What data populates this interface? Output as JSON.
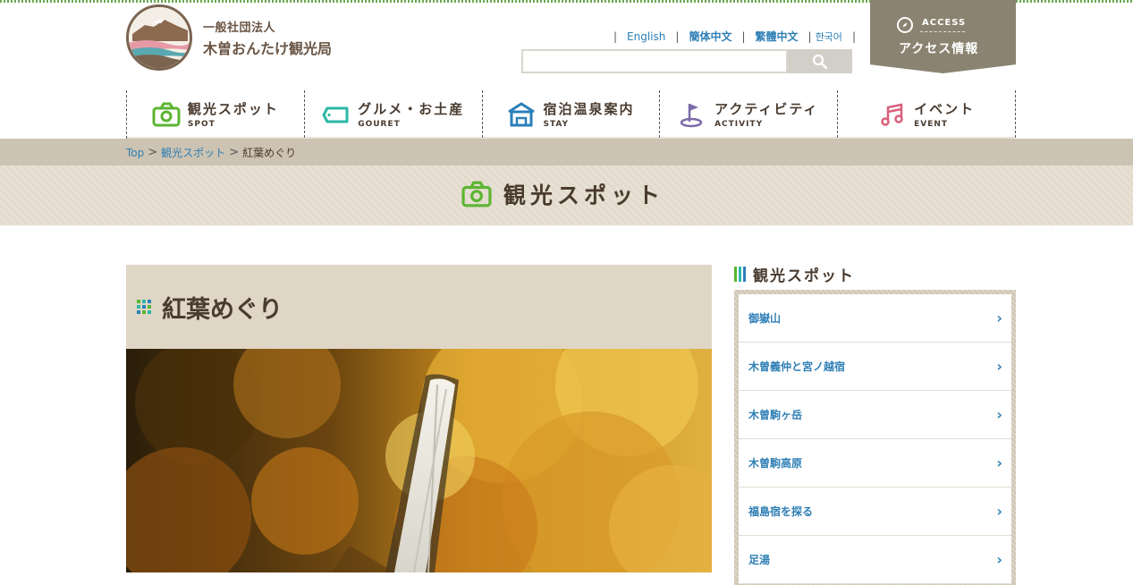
{
  "header": {
    "org_type": "一般社団法人",
    "org_name": "木曽おんたけ観光局",
    "languages": [
      "English",
      "簡体中文",
      "繁體中文",
      "한국어"
    ],
    "search": {
      "placeholder": "",
      "value": ""
    },
    "access": {
      "en": "ACCESS",
      "ja": "アクセス情報"
    }
  },
  "nav": [
    {
      "ja": "観光スポット",
      "en": "SPOT",
      "icon": "camera-icon",
      "color": "#5cb531"
    },
    {
      "ja": "グルメ・お土産",
      "en": "GOURET",
      "icon": "tag-icon",
      "color": "#2bb8a6"
    },
    {
      "ja": "宿泊温泉案内",
      "en": "STAY",
      "icon": "house-icon",
      "color": "#2a7fb8"
    },
    {
      "ja": "アクティビティ",
      "en": "ACTIVITY",
      "icon": "golf-flag-icon",
      "color": "#7c6aa8"
    },
    {
      "ja": "イベント",
      "en": "EVENT",
      "icon": "music-note-icon",
      "color": "#d9607a"
    }
  ],
  "breadcrumb": {
    "items": [
      "Top",
      "観光スポット"
    ],
    "current": "紅葉めぐり"
  },
  "section_title": "観光スポット",
  "article": {
    "title": "紅葉めぐり"
  },
  "sidebar": {
    "title": "観光スポット",
    "items": [
      "御嶽山",
      "木曽義仲と宮ノ越宿",
      "木曽駒ヶ岳",
      "木曽駒高原",
      "福島宿を探る",
      "足湯"
    ]
  },
  "colors": {
    "accent_green": "#5cb531",
    "link_blue": "#2f7fb5",
    "text_brown": "#4a3b2f",
    "access_bg": "#8a8371"
  }
}
